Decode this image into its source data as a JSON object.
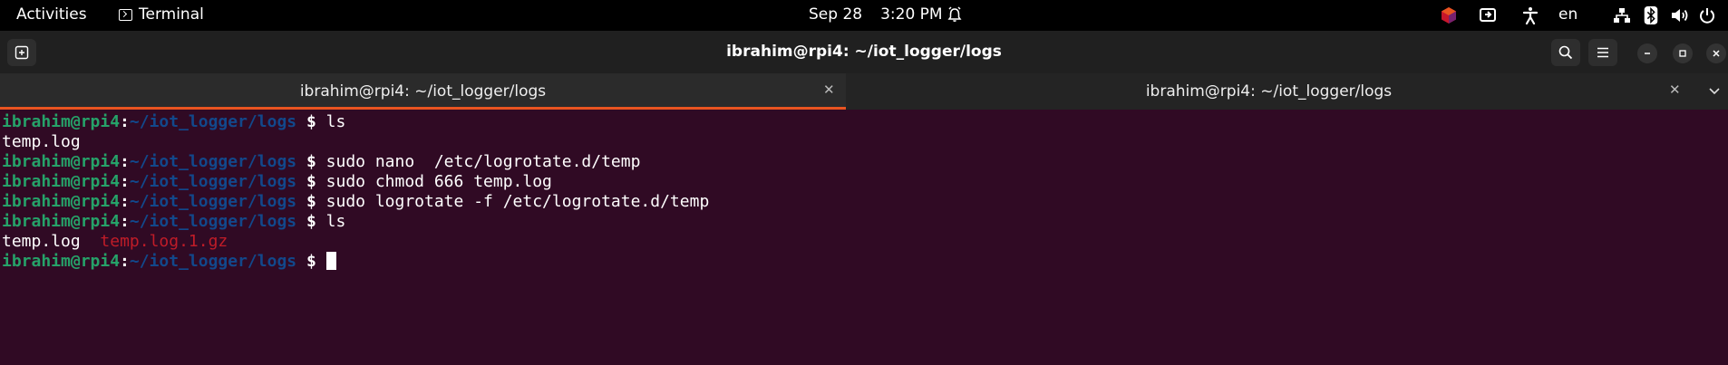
{
  "topbar": {
    "activities": "Activities",
    "app_name": "Terminal",
    "date": "Sep 28",
    "time": "3:20 PM",
    "language": "en"
  },
  "window": {
    "title": "ibrahim@rpi4: ~/iot_logger/logs"
  },
  "tabs": [
    {
      "label": "ibrahim@rpi4: ~/iot_logger/logs",
      "active": true
    },
    {
      "label": "ibrahim@rpi4: ~/iot_logger/logs",
      "active": false
    }
  ],
  "terminal": {
    "prompt_user": "ibrahim@rpi4",
    "prompt_sep": ":",
    "prompt_path": "~/iot_logger/logs",
    "prompt_end": " $ ",
    "lines": [
      {
        "type": "cmd",
        "text": "ls"
      },
      {
        "type": "out",
        "text": "temp.log"
      },
      {
        "type": "cmd",
        "text": "sudo nano  /etc/logrotate.d/temp"
      },
      {
        "type": "cmd",
        "text": "sudo chmod 666 temp.log"
      },
      {
        "type": "cmd",
        "text": "sudo logrotate -f /etc/logrotate.d/temp"
      },
      {
        "type": "cmd",
        "text": "ls"
      },
      {
        "type": "out2",
        "text": "temp.log",
        "text2": "temp.log.1.gz"
      },
      {
        "type": "cmd",
        "text": ""
      }
    ]
  },
  "colors": {
    "terminal_bg": "#300a24",
    "prompt_user": "#26a269",
    "prompt_path": "#12488b",
    "archive_file": "#c01c28",
    "tab_accent": "#e95420"
  },
  "icons": {
    "topbar_tray": [
      "ubuntu-pro-icon",
      "screen-share-icon",
      "accessibility-icon",
      "network-icon",
      "bluetooth-icon",
      "volume-icon",
      "power-icon"
    ]
  }
}
